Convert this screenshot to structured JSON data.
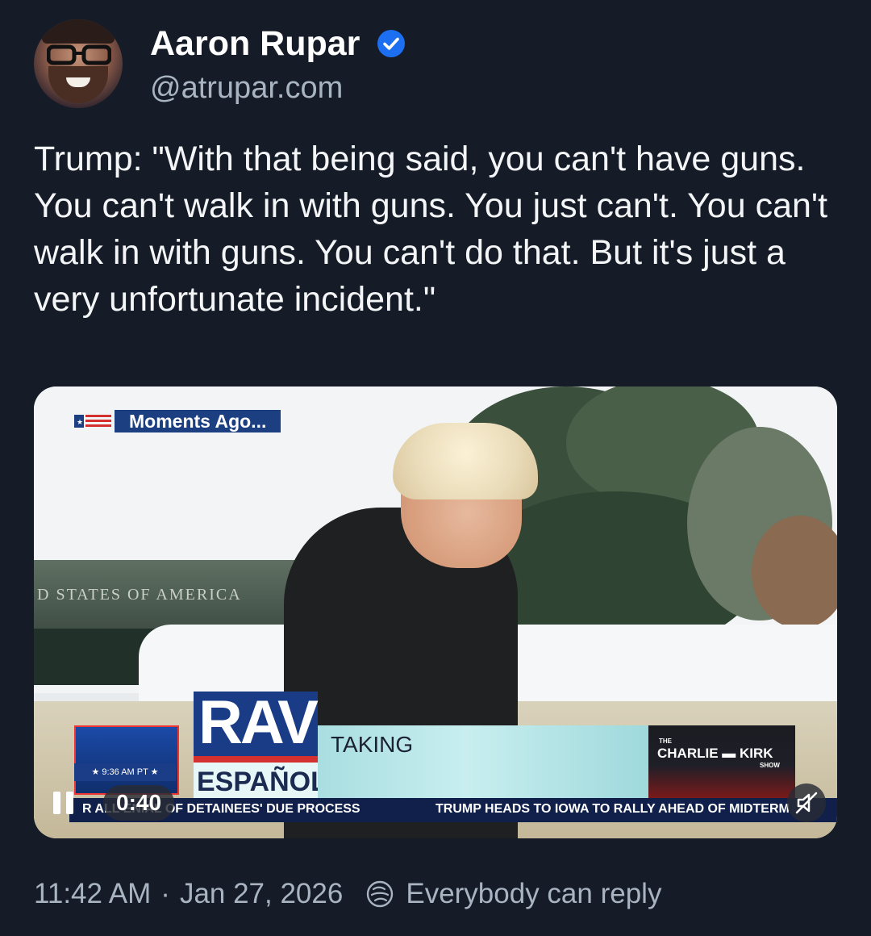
{
  "post": {
    "author_name": "Aaron Rupar",
    "handle": "@atrupar.com",
    "text": "Trump: \"With that being said, you can't have guns. You can't walk in with guns. You just can't. You can't walk in with guns. You can't do that. But it's just a very unfortunate incident.\"",
    "timestamp": "11:42 AM",
    "date": "Jan 27, 2026",
    "separator": "·",
    "reply_setting": "Everybody can reply"
  },
  "video": {
    "bug_label": "Moments Ago...",
    "background_text": "D STATES OF AMERICA",
    "network_logo": "RAV",
    "network_sub": "ESPAÑOL",
    "headline": "TAKING",
    "clock": "★ 9:36 AM PT ★",
    "show_the": "THE",
    "show_name": "CHARLIE ▬ KIRK",
    "show_sub": "SHOW",
    "ticker_1": "R ALL  ENIAL OF DETAINEES' DUE PROCESS",
    "ticker_2": "TRUMP HEADS TO IOWA TO RALLY AHEAD OF MIDTERM",
    "timecode": "0:40",
    "playing": true,
    "muted": true
  },
  "icons": {
    "verified": "verified-badge-icon",
    "pause": "pause-icon",
    "mute": "muted-speaker-icon",
    "reply": "reply-setting-icon"
  },
  "colors": {
    "background": "#161c27",
    "text_primary": "#f1f3f5",
    "text_secondary": "#a9b4c2",
    "verified_blue": "#1d6ff2"
  }
}
